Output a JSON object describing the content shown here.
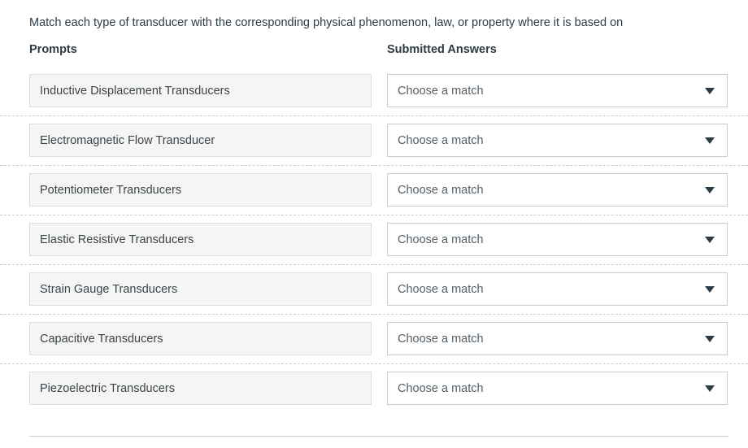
{
  "question": {
    "text": "Match each type of transducer with the corresponding physical phenomenon, law, or property where it is based on"
  },
  "columns": {
    "prompts_header": "Prompts",
    "answers_header": "Submitted Answers"
  },
  "icons": {
    "dropdown_caret": "chevron-down-icon"
  },
  "colors": {
    "prompt_background": "#f5f5f5",
    "prompt_border": "#dddddd",
    "answer_border": "#c7cdd1",
    "text": "#2d3b45",
    "placeholder_text": "#556069",
    "row_separator": "#c7cdd1"
  },
  "rows": [
    {
      "prompt": "Inductive Displacement Transducers",
      "answer": "Choose a match"
    },
    {
      "prompt": "Electromagnetic Flow Transducer",
      "answer": "Choose a match"
    },
    {
      "prompt": "Potentiometer Transducers",
      "answer": "Choose a match"
    },
    {
      "prompt": "Elastic Resistive Transducers",
      "answer": "Choose a match"
    },
    {
      "prompt": "Strain Gauge Transducers",
      "answer": "Choose a match"
    },
    {
      "prompt": "Capacitive Transducers",
      "answer": "Choose a match"
    },
    {
      "prompt": "Piezoelectric Transducers",
      "answer": "Choose a match"
    }
  ]
}
